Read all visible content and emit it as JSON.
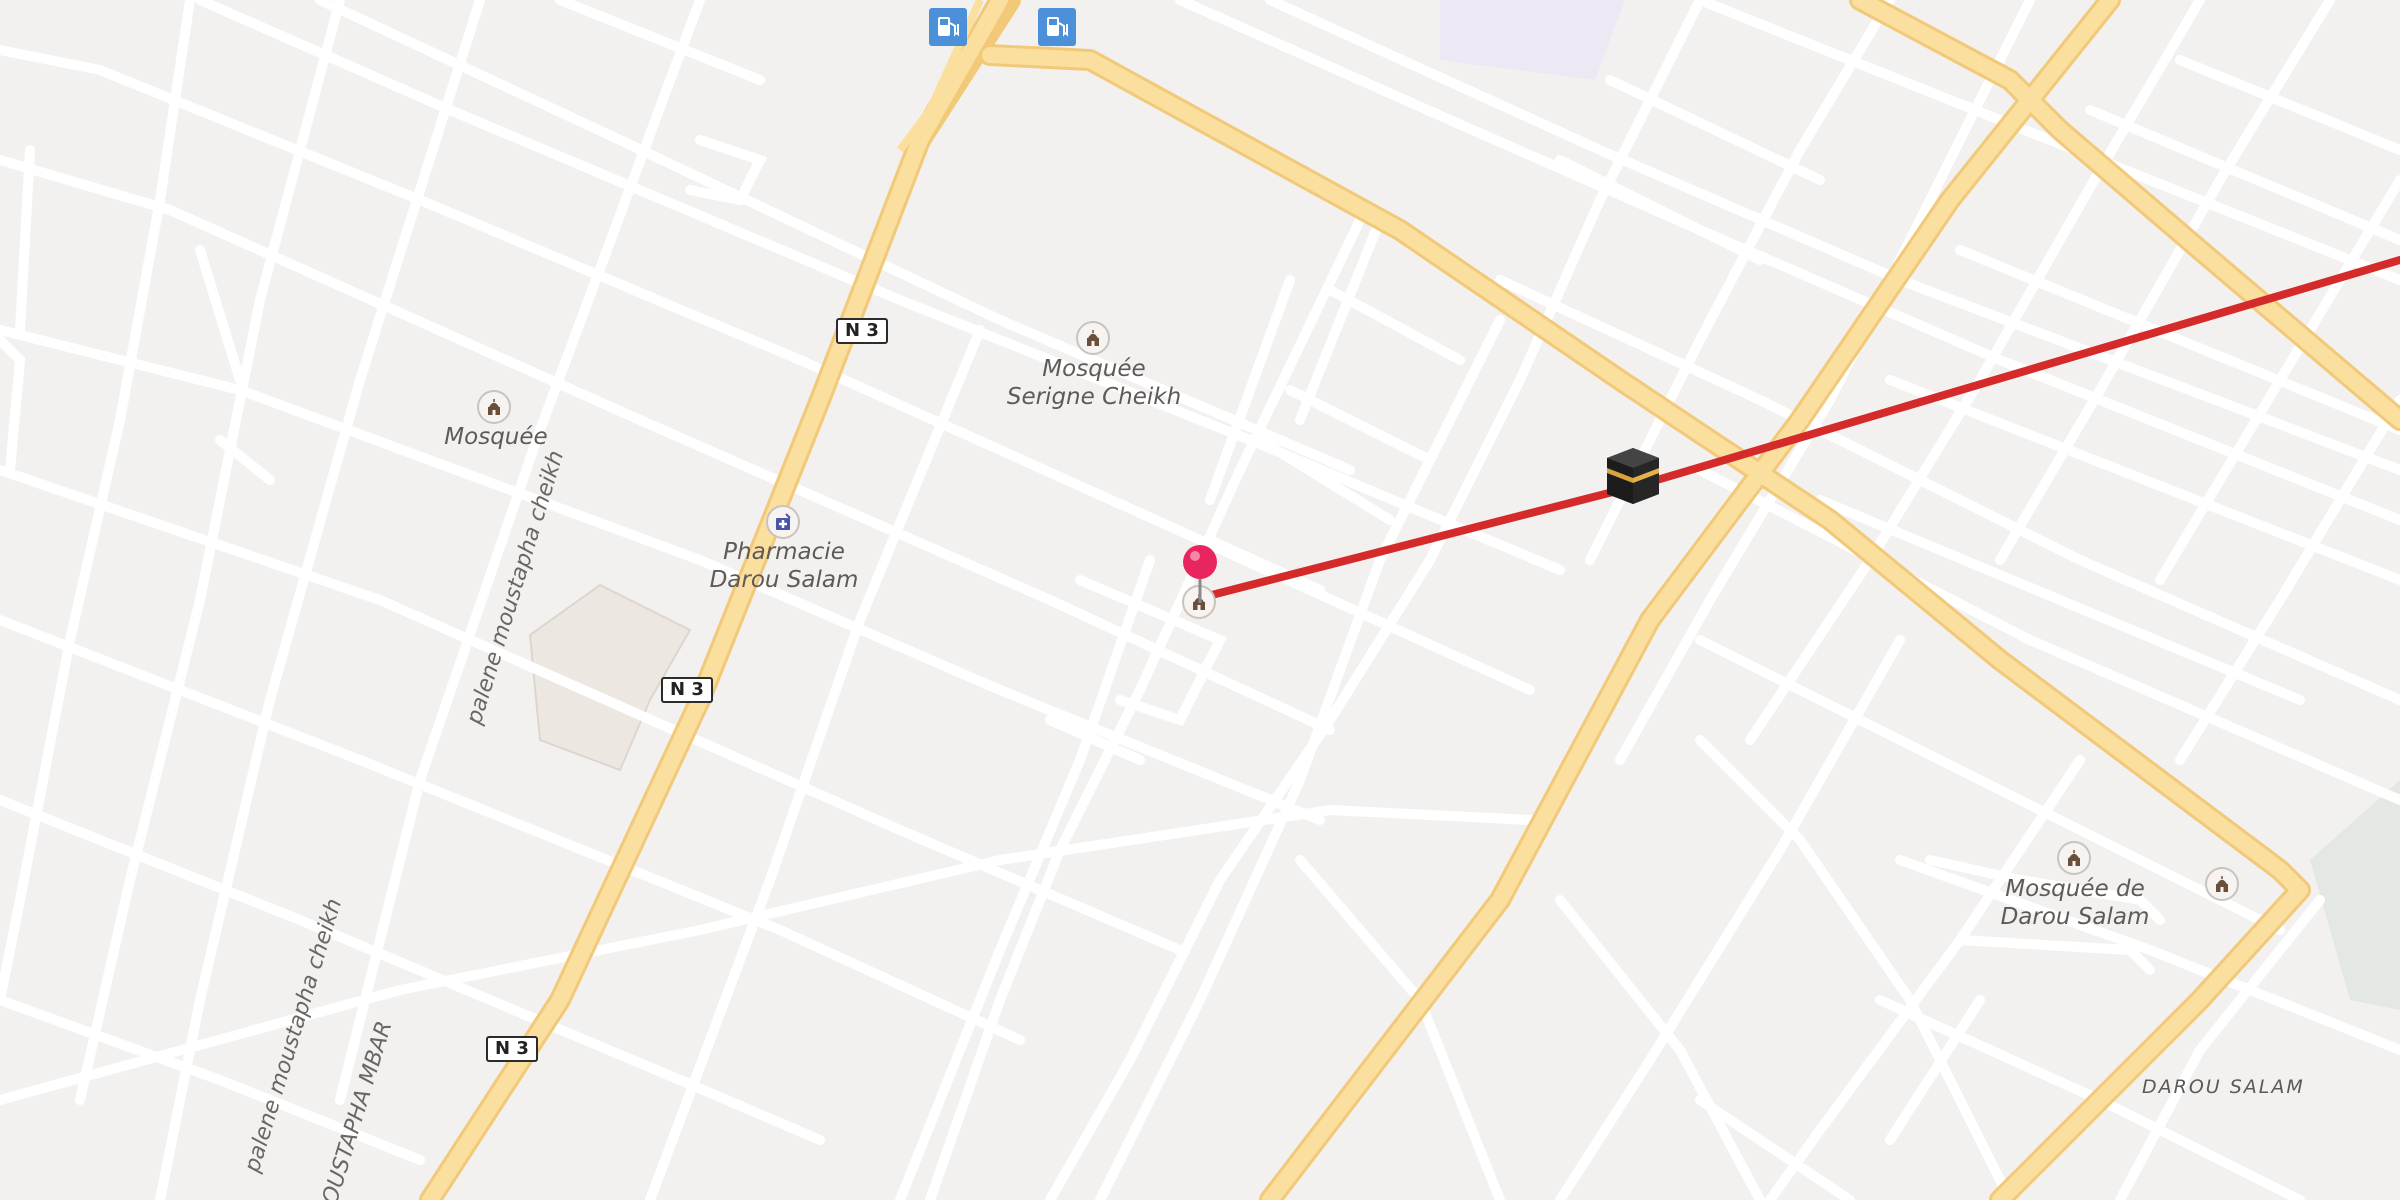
{
  "map": {
    "route_color": "#d42a2a",
    "pin_color": "#e8255e",
    "poi_labels": {
      "mosquee_serigne": "Mosquée\nSerigne Cheikh",
      "mosquee_west": "Mosquée",
      "pharmacie": "Pharmacie\nDarou Salam",
      "mosquee_darou": "Mosquée de\nDarou Salam"
    },
    "area_label": "DAROU SALAM",
    "street_labels": {
      "palene_1": "palene moustapha cheikh",
      "palene_2": "palene moustapha cheikh",
      "mbar": "OUSTAPHA MBAR"
    },
    "road_shields": [
      "N 3",
      "N 3",
      "N 3"
    ],
    "icons": {
      "fuel": "fuel-station-icon",
      "mosque": "mosque-icon",
      "pharmacy": "pharmacy-icon",
      "destination": "kaaba-icon",
      "location": "location-pin-icon"
    }
  }
}
